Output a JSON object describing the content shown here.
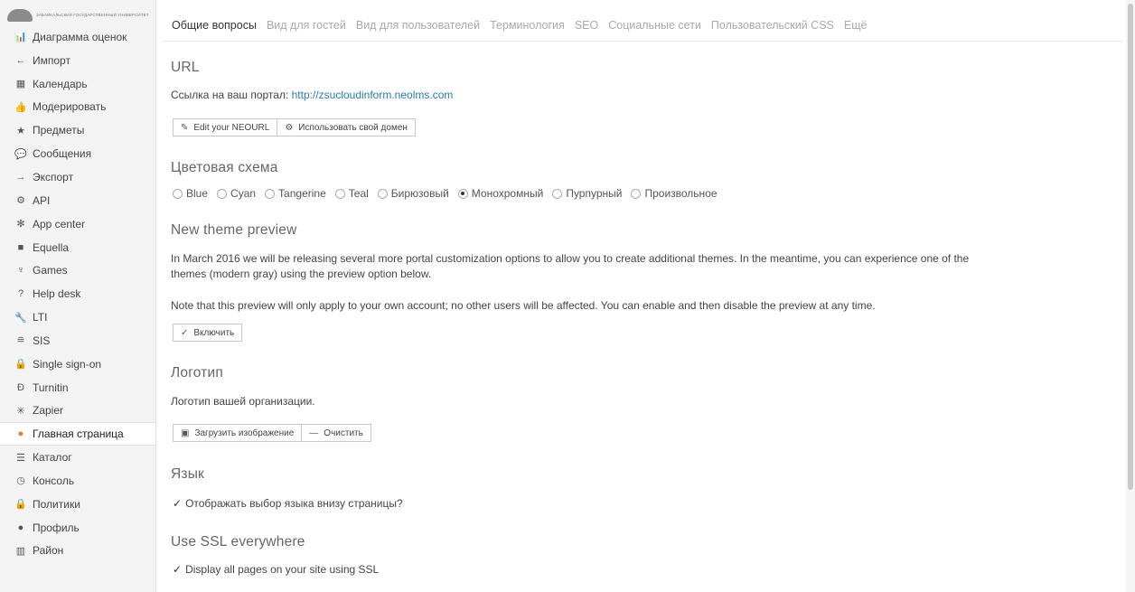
{
  "sidebar": {
    "logo_text": "ЗАБАЙКАЛЬСКИЙ ГОСУДАРСТВЕННЫЙ УНИВЕРСИТЕТ",
    "items": [
      {
        "icon": "bar-chart-icon",
        "glyph": "📊",
        "label": "Диаграмма оценок"
      },
      {
        "icon": "arrow-left-icon",
        "glyph": "←",
        "label": "Импорт"
      },
      {
        "icon": "calendar-icon",
        "glyph": "▦",
        "label": "Календарь"
      },
      {
        "icon": "thumbs-up-icon",
        "glyph": "👍",
        "label": "Модерировать"
      },
      {
        "icon": "star-icon",
        "glyph": "★",
        "label": "Предметы"
      },
      {
        "icon": "chat-icon",
        "glyph": "💬",
        "label": "Сообщения"
      },
      {
        "icon": "arrow-right-icon",
        "glyph": "→",
        "label": "Экспорт"
      },
      {
        "icon": "gear-icon",
        "glyph": "⚙",
        "label": "API"
      },
      {
        "icon": "cogs-icon",
        "glyph": "✻",
        "label": "App center"
      },
      {
        "icon": "equella-icon",
        "glyph": "■",
        "label": "Equella"
      },
      {
        "icon": "trophy-icon",
        "glyph": "♆",
        "label": "Games"
      },
      {
        "icon": "help-icon",
        "glyph": "?",
        "label": "Help desk"
      },
      {
        "icon": "wrench-icon",
        "glyph": "🔧",
        "label": "LTI"
      },
      {
        "icon": "database-icon",
        "glyph": "≘",
        "label": "SIS"
      },
      {
        "icon": "lock-icon",
        "glyph": "🔒",
        "label": "Single sign-on"
      },
      {
        "icon": "turnitin-icon",
        "glyph": "Ɖ",
        "label": "Turnitin"
      },
      {
        "icon": "zapier-icon",
        "glyph": "✳",
        "label": "Zapier"
      },
      {
        "icon": "home-globe-icon",
        "glyph": "●",
        "label": "Главная страница"
      },
      {
        "icon": "list-icon",
        "glyph": "☰",
        "label": "Каталог"
      },
      {
        "icon": "console-icon",
        "glyph": "◷",
        "label": "Консоль"
      },
      {
        "icon": "padlock-icon",
        "glyph": "🔒",
        "label": "Политики"
      },
      {
        "icon": "info-icon",
        "glyph": "●",
        "label": "Профиль"
      },
      {
        "icon": "district-icon",
        "glyph": "▥",
        "label": "Район"
      }
    ],
    "active_index": 17
  },
  "tabs": [
    {
      "label": "Общие вопросы",
      "active": true
    },
    {
      "label": "Вид для гостей",
      "active": false
    },
    {
      "label": "Вид для пользователей",
      "active": false
    },
    {
      "label": "Терминология",
      "active": false
    },
    {
      "label": "SEO",
      "active": false
    },
    {
      "label": "Социальные сети",
      "active": false
    },
    {
      "label": "Пользовательский CSS",
      "active": false
    },
    {
      "label": "Ещё",
      "active": false
    }
  ],
  "url": {
    "heading": "URL",
    "text": "Ссылка на ваш портал: ",
    "link": "http://zsucloudinform.neolms.com",
    "edit_button": "Edit your NEOURL",
    "domain_button": "Использовать свой домен"
  },
  "color_scheme": {
    "heading": "Цветовая схема",
    "options": [
      "Blue",
      "Cyan",
      "Tangerine",
      "Teal",
      "Бирюзовый",
      "Монохромный",
      "Пурпурный",
      "Произвольное"
    ],
    "selected": "Монохромный"
  },
  "preview": {
    "heading": "New theme preview",
    "text1": "In March 2016 we will be releasing several more portal customization options to allow you to create additional themes. In the meantime, you can experience one of the",
    "text1b": "themes (modern gray) using the preview option below.",
    "text2": "Note that this preview will only apply to your own account; no other users will be affected. You can enable and then disable the preview at any time.",
    "enable_button": "Включить"
  },
  "logo": {
    "heading": "Логотип",
    "text": "Логотип вашей организации.",
    "upload_button": "Загрузить изображение",
    "clear_button": "Очистить"
  },
  "language": {
    "heading": "Язык",
    "checkbox": "Отображать выбор языка внизу страницы?",
    "checked": true
  },
  "ssl": {
    "heading": "Use SSL everywhere",
    "checkbox": "Display all pages on your site using SSL",
    "checked": true
  }
}
